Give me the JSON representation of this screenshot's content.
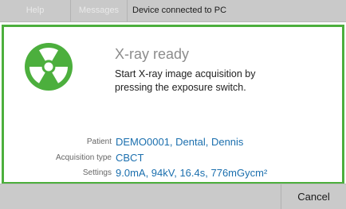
{
  "topbar": {
    "tabs": [
      {
        "label": "Help"
      },
      {
        "label": "Messages"
      }
    ],
    "status": "Device connected to PC"
  },
  "dialog": {
    "title": "X-ray ready",
    "message": "Start X-ray image acquisition by pressing the exposure switch.",
    "icon": "radiation-icon",
    "accent_color": "#4caf3d",
    "info": {
      "patient_label": "Patient",
      "patient_value": "DEMO0001, Dental, Dennis",
      "acquisition_label": "Acquisition type",
      "acquisition_value": "CBCT",
      "settings_label": "Settings",
      "settings_value": "9.0mA, 94kV, 16.4s, 776mGycm²"
    }
  },
  "footer": {
    "cancel_label": "Cancel"
  }
}
